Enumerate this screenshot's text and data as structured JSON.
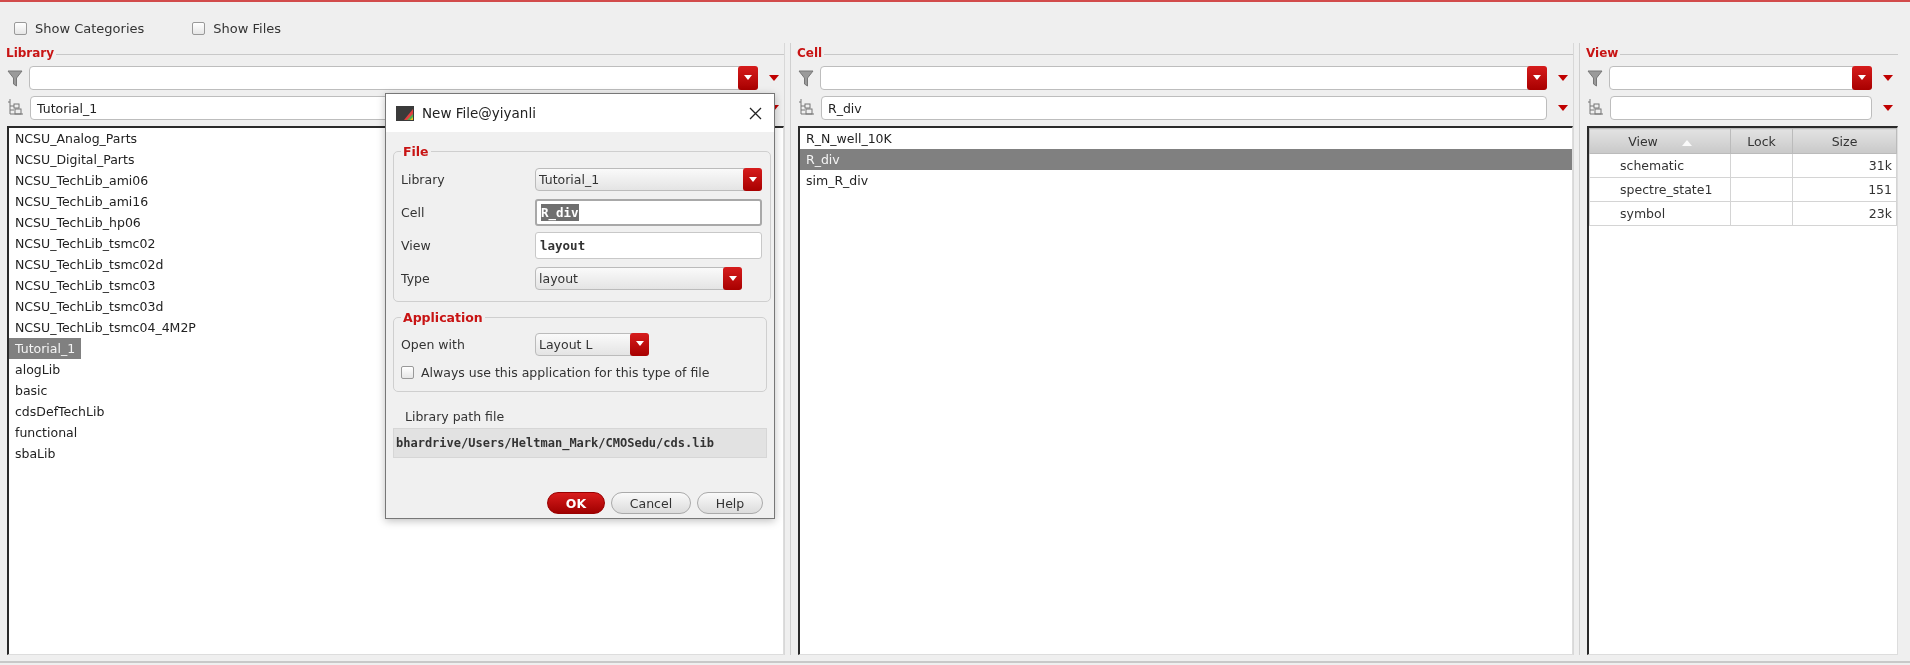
{
  "options": [
    {
      "label": "Show Categories",
      "checked": false
    },
    {
      "label": "Show Files",
      "checked": false
    }
  ],
  "panels": [
    {
      "kind": "list",
      "title": "Library",
      "selector": "Tutorial_1",
      "items": [
        {
          "label": "NCSU_Analog_Parts",
          "selected": false
        },
        {
          "label": "NCSU_Digital_Parts",
          "selected": false
        },
        {
          "label": "NCSU_TechLib_ami06",
          "selected": false
        },
        {
          "label": "NCSU_TechLib_ami16",
          "selected": false
        },
        {
          "label": "NCSU_TechLib_hp06",
          "selected": false
        },
        {
          "label": "NCSU_TechLib_tsmc02",
          "selected": false
        },
        {
          "label": "NCSU_TechLib_tsmc02d",
          "selected": false
        },
        {
          "label": "NCSU_TechLib_tsmc03",
          "selected": false
        },
        {
          "label": "NCSU_TechLib_tsmc03d",
          "selected": false
        },
        {
          "label": "NCSU_TechLib_tsmc04_4M2P",
          "selected": false
        },
        {
          "label": "Tutorial_1",
          "selected": true
        },
        {
          "label": "alogLib",
          "selected": false
        },
        {
          "label": "basic",
          "selected": false
        },
        {
          "label": "cdsDefTechLib",
          "selected": false
        },
        {
          "label": "functional",
          "selected": false
        },
        {
          "label": "sbaLib",
          "selected": false
        }
      ]
    },
    {
      "kind": "list",
      "title": "Cell",
      "selector": "R_div",
      "items": [
        {
          "label": "R_N_well_10K",
          "selected": false
        },
        {
          "label": "R_div",
          "selected": true
        },
        {
          "label": "sim_R_div",
          "selected": false
        }
      ]
    },
    {
      "kind": "table",
      "title": "View",
      "columns": [
        {
          "label": "View",
          "sorted": true
        },
        {
          "label": "Lock",
          "sorted": false
        },
        {
          "label": "Size",
          "sorted": false
        }
      ],
      "rows": [
        [
          "schematic",
          "",
          "31k"
        ],
        [
          "spectre_state1",
          "",
          "151"
        ],
        [
          "symbol",
          "",
          "23k"
        ]
      ]
    }
  ],
  "dialog": {
    "title": "New File@yiyanli",
    "file": {
      "title": "File",
      "fields": [
        {
          "label": "Library",
          "kind": "dropdown",
          "value": "Tutorial_1"
        },
        {
          "label": "Cell",
          "kind": "text",
          "value": "R_div",
          "highlighted": true
        },
        {
          "label": "View",
          "kind": "text",
          "value": "layout",
          "highlighted": false
        },
        {
          "label": "Type",
          "kind": "dropdown",
          "value": "layout"
        }
      ]
    },
    "application": {
      "title": "Application",
      "open_with_label": "Open with",
      "open_with": "Layout L",
      "remember": {
        "label": "Always use this application for this type of file",
        "checked": false
      }
    },
    "path_label": "Library path file",
    "path": "bhardrive/Users/Heltman_Mark/CMOSedu/cds.lib",
    "buttons": [
      {
        "label": "OK",
        "default": true
      },
      {
        "label": "Cancel",
        "default": false
      },
      {
        "label": "Help",
        "default": false
      }
    ]
  }
}
